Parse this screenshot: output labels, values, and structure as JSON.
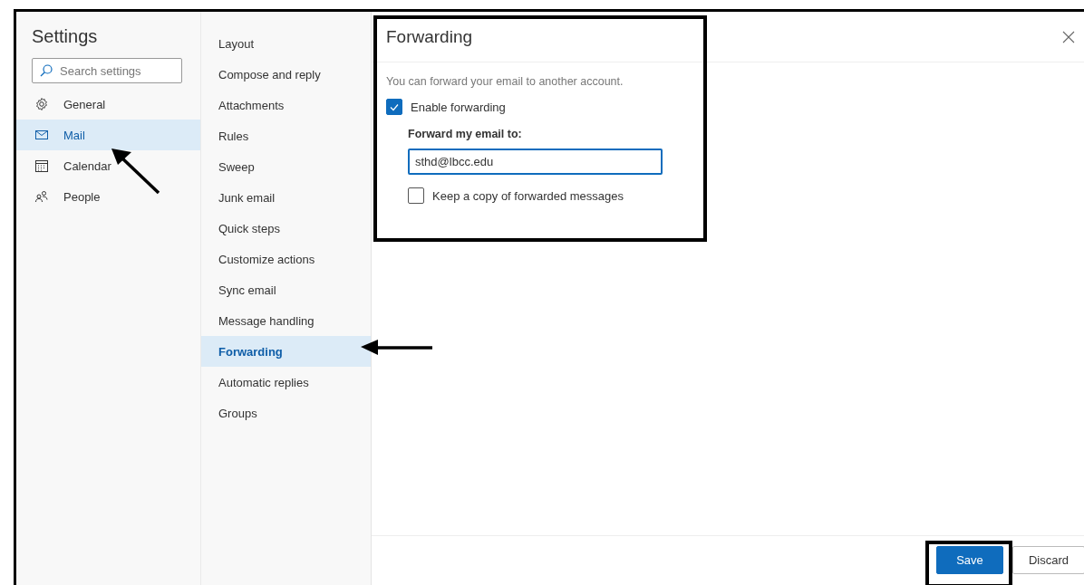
{
  "sidebar": {
    "title": "Settings",
    "search": {
      "placeholder": "Search settings"
    },
    "items": [
      {
        "label": "General",
        "kind": "gear",
        "selected": false
      },
      {
        "label": "Mail",
        "kind": "mail",
        "selected": true
      },
      {
        "label": "Calendar",
        "kind": "calendar",
        "selected": false
      },
      {
        "label": "People",
        "kind": "people",
        "selected": false
      }
    ]
  },
  "subnav": {
    "items": [
      {
        "label": "Layout",
        "selected": false
      },
      {
        "label": "Compose and reply",
        "selected": false
      },
      {
        "label": "Attachments",
        "selected": false
      },
      {
        "label": "Rules",
        "selected": false
      },
      {
        "label": "Sweep",
        "selected": false
      },
      {
        "label": "Junk email",
        "selected": false
      },
      {
        "label": "Quick steps",
        "selected": false
      },
      {
        "label": "Customize actions",
        "selected": false
      },
      {
        "label": "Sync email",
        "selected": false
      },
      {
        "label": "Message handling",
        "selected": false
      },
      {
        "label": "Forwarding",
        "selected": true
      },
      {
        "label": "Automatic replies",
        "selected": false
      },
      {
        "label": "Groups",
        "selected": false
      }
    ]
  },
  "panel": {
    "title": "Forwarding",
    "description": "You can forward your email to another account.",
    "enable": {
      "label": "Enable forwarding",
      "checked": true
    },
    "field": {
      "label": "Forward my email to:",
      "value": "sthd@lbcc.edu"
    },
    "keep_copy": {
      "label": "Keep a copy of forwarded messages",
      "checked": false
    }
  },
  "buttons": [
    {
      "label": "Save",
      "kind": "primary"
    },
    {
      "label": "Discard",
      "kind": "default"
    }
  ]
}
